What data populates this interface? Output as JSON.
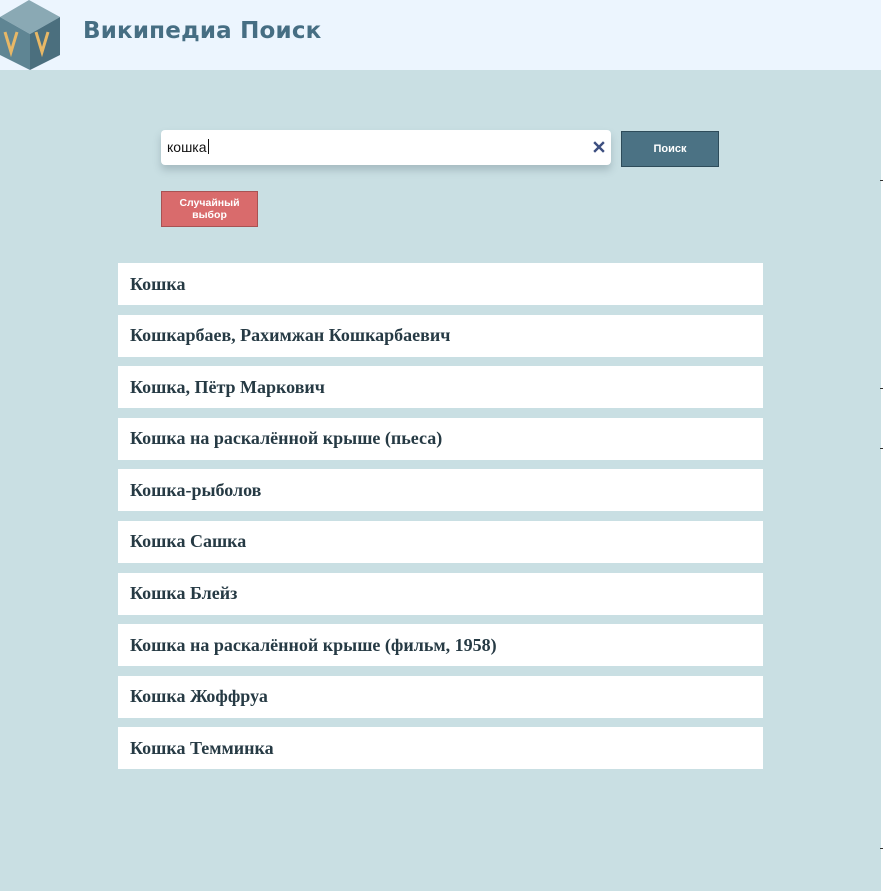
{
  "header": {
    "title": "Википедиа Поиск",
    "logo_icon": "cube-vv-logo-icon",
    "background": "#ecf5fe",
    "title_color": "#466e83"
  },
  "search": {
    "value": "кошка",
    "clear_icon": "close-icon",
    "submit_label": "Поиск",
    "submit_color": "#4b7284"
  },
  "random": {
    "label": "Случайный выбор",
    "color": "#d96b6c"
  },
  "results": [
    {
      "title": "Кошка"
    },
    {
      "title": "Кошкарбаев, Рахимжан Кошкарбаевич"
    },
    {
      "title": "Кошка, Пётр Маркович"
    },
    {
      "title": "Кошка на раскалённой крыше (пьеса)"
    },
    {
      "title": "Кошка-рыболов"
    },
    {
      "title": "Кошка Сашка"
    },
    {
      "title": "Кошка Блейз"
    },
    {
      "title": "Кошка на раскалённой крыше (фильм, 1958)"
    },
    {
      "title": "Кошка Жоффруа"
    },
    {
      "title": "Кошка Темминка"
    }
  ],
  "colors": {
    "page_background": "#c9dfe3",
    "result_text": "#263a44"
  }
}
